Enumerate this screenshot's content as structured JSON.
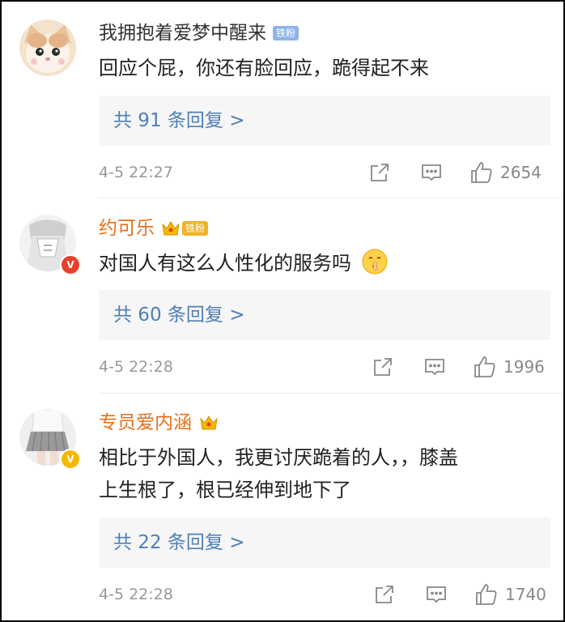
{
  "comments": [
    {
      "username": "我拥抱着爱梦中醒来",
      "fan_tag": "铁粉",
      "text": "回应个屁，你还有脸回应，跪得起不来",
      "replies_label": "共 91 条回复 >",
      "time": "4-5 22:27",
      "likes": "2654"
    },
    {
      "username": "约可乐",
      "fan_tag": "铁粉",
      "text": "对国人有这么人性化的服务吗",
      "replies_label": "共 60 条回复 >",
      "time": "4-5 22:28",
      "likes": "1996"
    },
    {
      "username": "专员爱内涵",
      "text_line1": "相比于外国人，我更讨厌跪着的人，，膝盖",
      "text_line2": "上生根了，根已经伸到地下了",
      "replies_label": "共 22 条回复 >",
      "time": "4-5 22:28",
      "likes": "1740"
    }
  ],
  "colors": {
    "orange_name": "#e8701a",
    "gray_name": "#333333",
    "reply_link": "#4f7fb5",
    "fan_tag_blue": "#8fb2e8",
    "fan_tag_gold": "#f0b229",
    "verified_red": "#e8402a",
    "verified_gold": "#f5b800"
  },
  "icons": [
    "share-icon",
    "comment-icon",
    "like-icon",
    "crown-icon",
    "verified-badge-icon",
    "shush-emoji-icon"
  ]
}
